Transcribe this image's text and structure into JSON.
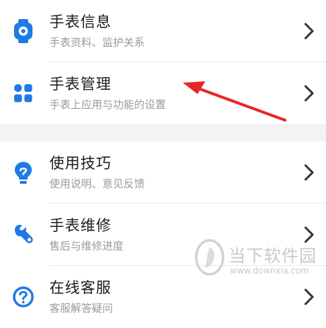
{
  "accent_color": "#1f7ae6",
  "arrow_color": "#e8252a",
  "menu_group_1": [
    {
      "title": "手表信息",
      "subtitle": "手表资料、监护关系",
      "icon": "watch-icon"
    },
    {
      "title": "手表管理",
      "subtitle": "手表上应用与功能的设置",
      "icon": "apps-grid-icon"
    }
  ],
  "menu_group_2": [
    {
      "title": "使用技巧",
      "subtitle": "使用说明、意见反馈",
      "icon": "lightbulb-icon"
    },
    {
      "title": "手表维修",
      "subtitle": "售后与维修进度",
      "icon": "wrench-icon"
    },
    {
      "title": "在线客服",
      "subtitle": "客服解答疑问",
      "icon": "help-circle-icon"
    }
  ],
  "watermark": {
    "name": "当下软件园",
    "url": "www.downxia.com"
  }
}
